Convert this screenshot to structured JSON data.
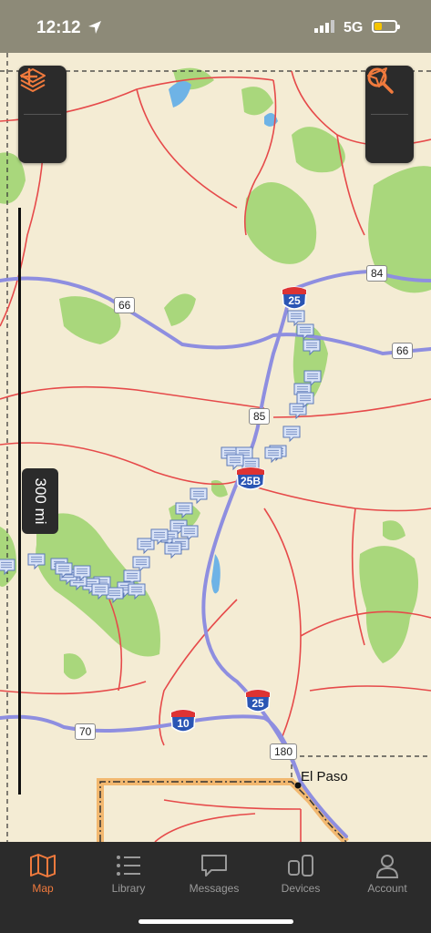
{
  "status": {
    "time": "12:12",
    "network": "5G",
    "battery_level": 0.35,
    "battery_color": "#f5c400"
  },
  "map": {
    "scale_label": "300 mi",
    "controls": [
      {
        "name": "layers-icon"
      },
      {
        "name": "plus-icon"
      },
      {
        "name": "search-icon"
      },
      {
        "name": "navigation-arrow-icon"
      }
    ],
    "interstates": [
      "25",
      "25B",
      "25",
      "10"
    ],
    "road_labels": [
      "66",
      "84",
      "66",
      "85",
      "70",
      "180"
    ],
    "cities": [
      "El Paso"
    ],
    "waypoint_count": 38,
    "colors": {
      "land": "#f4ecd4",
      "forest": "#a9d77c",
      "interstate": "#8e8ee0",
      "highway": "#e64a4a",
      "accent": "#f07a3d"
    }
  },
  "tabs": [
    {
      "label": "Map",
      "active": true,
      "icon": "map-icon"
    },
    {
      "label": "Library",
      "active": false,
      "icon": "list-icon"
    },
    {
      "label": "Messages",
      "active": false,
      "icon": "message-icon"
    },
    {
      "label": "Devices",
      "active": false,
      "icon": "devices-icon"
    },
    {
      "label": "Account",
      "active": false,
      "icon": "person-icon"
    }
  ]
}
